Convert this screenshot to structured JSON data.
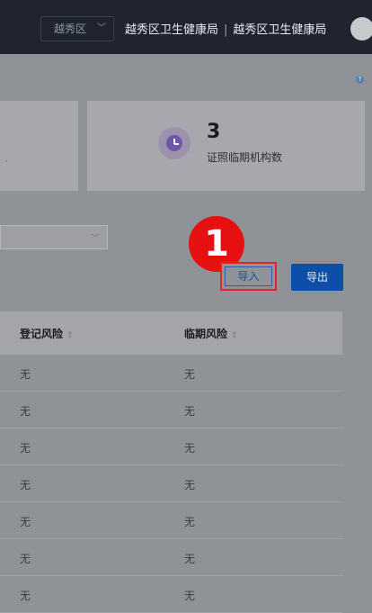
{
  "header": {
    "district": "越秀区",
    "org_name": "越秀区卫生健康局",
    "separator": "|",
    "user_name": "越秀区卫生健康局"
  },
  "stats": {
    "expiring_card": {
      "value": "3",
      "label": "证照临期机构数",
      "icon": "clock-icon"
    }
  },
  "toolbar": {
    "step_number": "1",
    "import_label": "导入",
    "export_label": "导出"
  },
  "table": {
    "columns": [
      {
        "label": "登记风险",
        "sortable": true
      },
      {
        "label": "临期风险",
        "sortable": true
      }
    ],
    "rows": [
      [
        "无",
        "无"
      ],
      [
        "无",
        "无"
      ],
      [
        "无",
        "无"
      ],
      [
        "无",
        "无"
      ],
      [
        "无",
        "无"
      ],
      [
        "无",
        "无"
      ],
      [
        "无",
        "无"
      ]
    ]
  },
  "colors": {
    "topbar": "#1f242e",
    "overlay": "#8f9297",
    "step_badge": "#e61010",
    "highlight_border": "#e0222a",
    "export_button": "#0d4fa8",
    "icon_purple": "#6e56a8"
  }
}
